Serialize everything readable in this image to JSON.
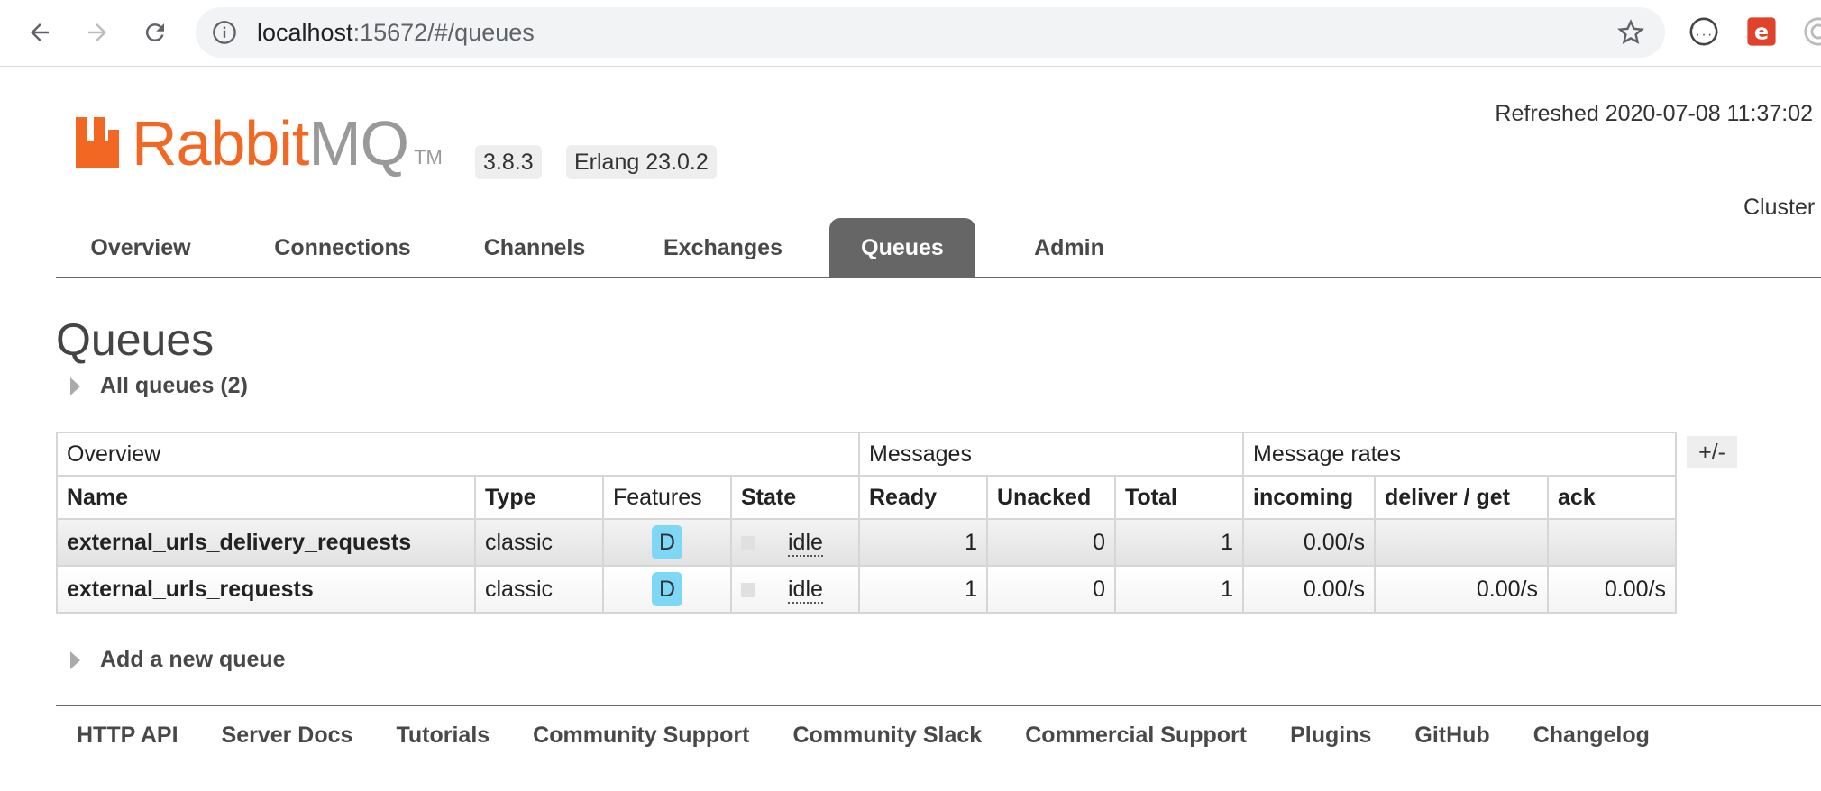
{
  "browser": {
    "url_host": "localhost",
    "url_rest": ":15672/#/queues"
  },
  "header": {
    "logo_brand": "Rabbit",
    "logo_mq": "MQ",
    "logo_tm": "TM",
    "version": "3.8.3",
    "erlang": "Erlang 23.0.2",
    "refreshed": "Refreshed 2020-07-08 11:37:02",
    "cluster": "Cluster"
  },
  "tabs": [
    {
      "label": "Overview"
    },
    {
      "label": "Connections"
    },
    {
      "label": "Channels"
    },
    {
      "label": "Exchanges"
    },
    {
      "label": "Queues"
    },
    {
      "label": "Admin"
    }
  ],
  "page": {
    "title": "Queues",
    "all_queues": "All queues (2)",
    "add_queue": "Add a new queue",
    "plusminus": "+/-"
  },
  "table": {
    "groups": [
      "Overview",
      "Messages",
      "Message rates"
    ],
    "columns": [
      "Name",
      "Type",
      "Features",
      "State",
      "Ready",
      "Unacked",
      "Total",
      "incoming",
      "deliver / get",
      "ack"
    ],
    "rows": [
      {
        "name": "external_urls_delivery_requests",
        "type": "classic",
        "feature": "D",
        "state": "idle",
        "ready": "1",
        "unacked": "0",
        "total": "1",
        "incoming": "0.00/s",
        "deliver": "",
        "ack": ""
      },
      {
        "name": "external_urls_requests",
        "type": "classic",
        "feature": "D",
        "state": "idle",
        "ready": "1",
        "unacked": "0",
        "total": "1",
        "incoming": "0.00/s",
        "deliver": "0.00/s",
        "ack": "0.00/s"
      }
    ]
  },
  "footer": [
    "HTTP API",
    "Server Docs",
    "Tutorials",
    "Community Support",
    "Community Slack",
    "Commercial Support",
    "Plugins",
    "GitHub",
    "Changelog"
  ],
  "colors": {
    "brand": "#f26722",
    "active_tab": "#666666",
    "feature_badge": "#7dd7f5"
  }
}
